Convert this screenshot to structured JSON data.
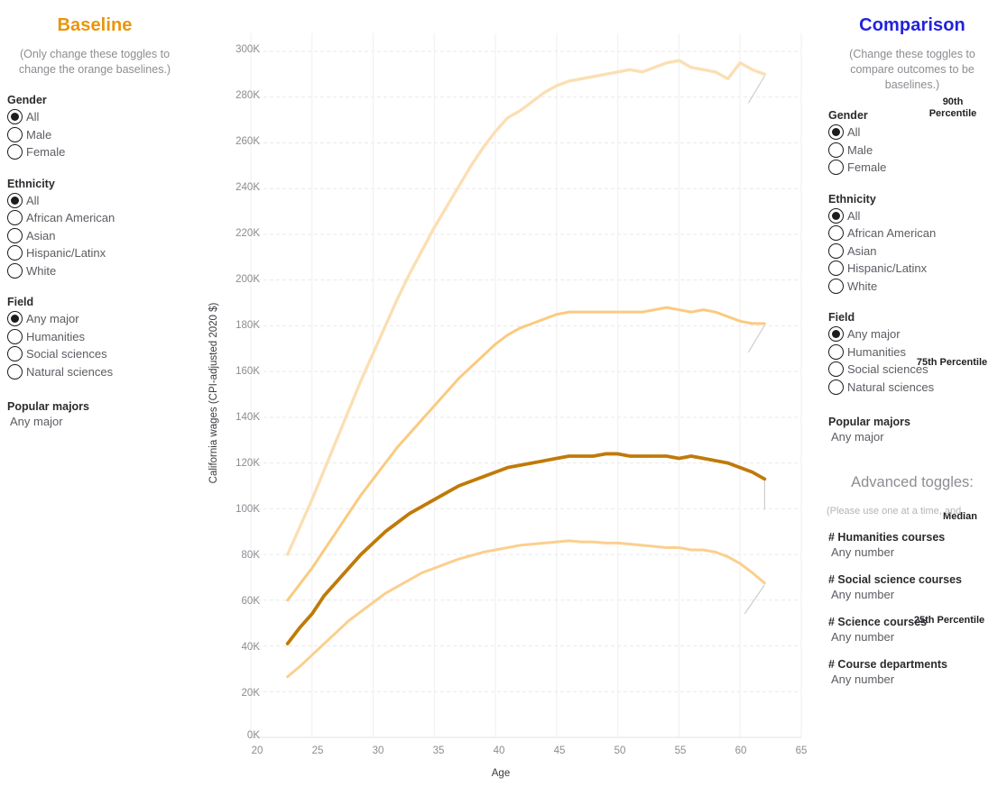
{
  "baseline": {
    "title": "Baseline",
    "title_color": "#e8960c",
    "subtitle": "(Only change these toggles to change the orange baselines.)",
    "groups": [
      {
        "label": "Gender",
        "options": [
          "All",
          "Male",
          "Female"
        ],
        "selected": 0
      },
      {
        "label": "Ethnicity",
        "options": [
          "All",
          "African American",
          "Asian",
          "Hispanic/Latinx",
          "White"
        ],
        "selected": 0
      },
      {
        "label": "Field",
        "options": [
          "Any major",
          "Humanities",
          "Social sciences",
          "Natural sciences"
        ],
        "selected": 0
      }
    ],
    "popular_majors": {
      "label": "Popular majors",
      "value": "Any major"
    }
  },
  "comparison": {
    "title": "Comparison",
    "title_color": "#2222dd",
    "subtitle": "(Change these toggles to compare outcomes to be baselines.)",
    "groups": [
      {
        "label": "Gender",
        "options": [
          "All",
          "Male",
          "Female"
        ],
        "selected": 0
      },
      {
        "label": "Ethnicity",
        "options": [
          "All",
          "African American",
          "Asian",
          "Hispanic/Latinx",
          "White"
        ],
        "selected": 0
      },
      {
        "label": "Field",
        "options": [
          "Any major",
          "Humanities",
          "Social sciences",
          "Natural sciences"
        ],
        "selected": 0
      }
    ],
    "popular_majors": {
      "label": "Popular majors",
      "value": "Any major"
    },
    "advanced": {
      "heading": "Advanced toggles:",
      "note": "(Please use one at a time, and..",
      "items": [
        {
          "label": "# Humanities courses",
          "value": "Any number"
        },
        {
          "label": "# Social science courses",
          "value": "Any number"
        },
        {
          "label": "# Science courses",
          "value": "Any number"
        },
        {
          "label": "# Course departments",
          "value": "Any number"
        }
      ]
    }
  },
  "chart_data": {
    "type": "line",
    "title": "",
    "xlabel": "Age",
    "ylabel": "California wages (CPI-adjusted 2020 $)",
    "xlim": [
      20,
      65
    ],
    "ylim": [
      0,
      305000
    ],
    "xticks": [
      20,
      25,
      30,
      35,
      40,
      45,
      50,
      55,
      60,
      65
    ],
    "yticks": [
      0,
      20000,
      40000,
      60000,
      80000,
      100000,
      120000,
      140000,
      160000,
      180000,
      200000,
      220000,
      240000,
      260000,
      280000,
      300000
    ],
    "ytick_labels": [
      "0K",
      "20K",
      "40K",
      "60K",
      "80K",
      "100K",
      "120K",
      "140K",
      "160K",
      "180K",
      "200K",
      "220K",
      "240K",
      "260K",
      "280K",
      "300K"
    ],
    "grid": true,
    "legend": "inline-endpoint-labels",
    "colors": {
      "p90": "#fbdfb4",
      "p75": "#fbca80",
      "median": "#c07a09",
      "p25": "#fbcf8e"
    },
    "x": [
      23,
      24,
      25,
      26,
      27,
      28,
      29,
      30,
      31,
      32,
      33,
      34,
      35,
      36,
      37,
      38,
      39,
      40,
      41,
      42,
      43,
      44,
      45,
      46,
      47,
      48,
      49,
      50,
      51,
      52,
      53,
      54,
      55,
      56,
      57,
      58,
      59,
      60,
      61,
      62
    ],
    "series": [
      {
        "name": "90th Percentile",
        "color": "#fbdfb4",
        "label": "90th\nPercentile",
        "values": [
          80000,
          92000,
          104000,
          117000,
          130000,
          143000,
          156000,
          168000,
          180000,
          192000,
          203000,
          213000,
          223000,
          232000,
          241000,
          250000,
          258000,
          265000,
          271000,
          274000,
          278000,
          282000,
          285000,
          287000,
          288000,
          289000,
          290000,
          291000,
          292000,
          291000,
          293000,
          295000,
          296000,
          293000,
          292000,
          291000,
          288000,
          295000,
          292000,
          290000
        ]
      },
      {
        "name": "75th Percentile",
        "color": "#fbca80",
        "label": "75th Percentile",
        "values": [
          60000,
          67000,
          74000,
          82000,
          90000,
          98000,
          106000,
          113000,
          120000,
          127000,
          133000,
          139000,
          145000,
          151000,
          157000,
          162000,
          167000,
          172000,
          176000,
          179000,
          181000,
          183000,
          185000,
          186000,
          186000,
          186000,
          186000,
          186000,
          186000,
          186000,
          187000,
          188000,
          187000,
          186000,
          187000,
          186000,
          184000,
          182000,
          181000,
          181000
        ]
      },
      {
        "name": "Median",
        "color": "#c07a09",
        "label": "Median",
        "values": [
          41000,
          48000,
          54000,
          62000,
          68000,
          74000,
          80000,
          85000,
          90000,
          94000,
          98000,
          101000,
          104000,
          107000,
          110000,
          112000,
          114000,
          116000,
          118000,
          119000,
          120000,
          121000,
          122000,
          123000,
          123000,
          123000,
          124000,
          124000,
          123000,
          123000,
          123000,
          123000,
          122000,
          123000,
          122000,
          121000,
          120000,
          118000,
          116000,
          113000
        ]
      },
      {
        "name": "25th Percentile",
        "color": "#fbcf8e",
        "label": "25th Percentile",
        "values": [
          26500,
          31000,
          36000,
          41000,
          46000,
          51000,
          55000,
          59000,
          63000,
          66000,
          69000,
          72000,
          74000,
          76000,
          78000,
          79500,
          81000,
          82000,
          83000,
          84000,
          84500,
          85000,
          85500,
          86000,
          85500,
          85500,
          85000,
          85000,
          84500,
          84000,
          83500,
          83000,
          83000,
          82000,
          82000,
          81000,
          79000,
          76000,
          72000,
          67500
        ]
      }
    ],
    "endpoint_labels": [
      {
        "text": "90th\nPercentile",
        "x": 856,
        "y": 113
      },
      {
        "text": "75th Percentile",
        "x": 855,
        "y": 397
      },
      {
        "text": "Median",
        "x": 864,
        "y": 568
      },
      {
        "text": "25th Percentile",
        "x": 852,
        "y": 683
      }
    ]
  }
}
